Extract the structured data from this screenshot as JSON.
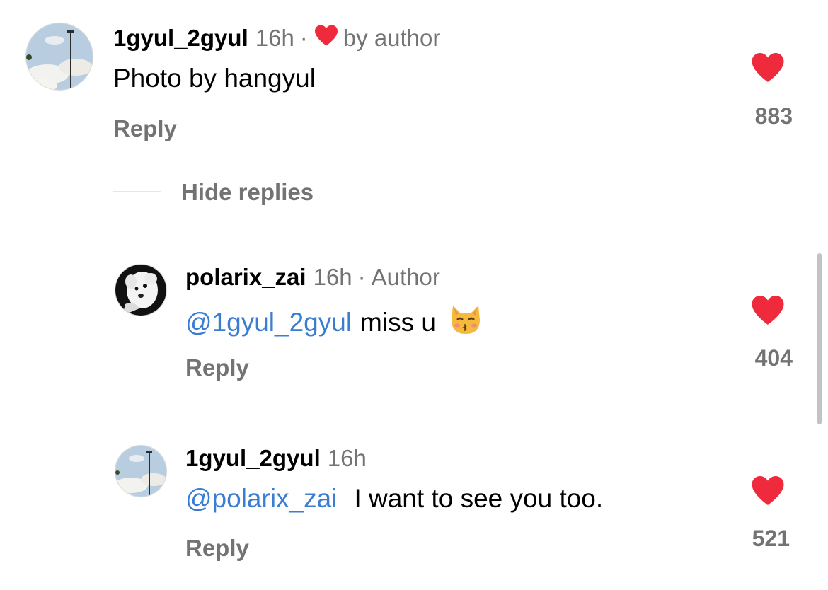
{
  "comment": {
    "username": "1gyul_2gyul",
    "time": "16h",
    "dot": "·",
    "liked_by": "by author",
    "text": "Photo by hangyul",
    "reply_label": "Reply",
    "likes": "883",
    "avatar_icon": "sky-streetlamp-avatar",
    "heart_color": "#ee2a3c"
  },
  "hide_replies_label": "Hide replies",
  "replies": [
    {
      "username": "polarix_zai",
      "time": "16h",
      "dot": "·",
      "badge": "Author",
      "mention": "@1gyul_2gyul",
      "text": "miss u",
      "emoji": "kissing-cat-emoji",
      "reply_label": "Reply",
      "likes": "404",
      "avatar_icon": "bw-dog-avatar"
    },
    {
      "username": "1gyul_2gyul",
      "time": "16h",
      "mention": "@polarix_zai",
      "text": "I want to see you too.",
      "reply_label": "Reply",
      "likes": "521",
      "avatar_icon": "sky-streetlamp-avatar"
    }
  ],
  "colors": {
    "mention": "#3a7dd1",
    "secondary_text": "#737373",
    "heart": "#ee2a3c"
  }
}
